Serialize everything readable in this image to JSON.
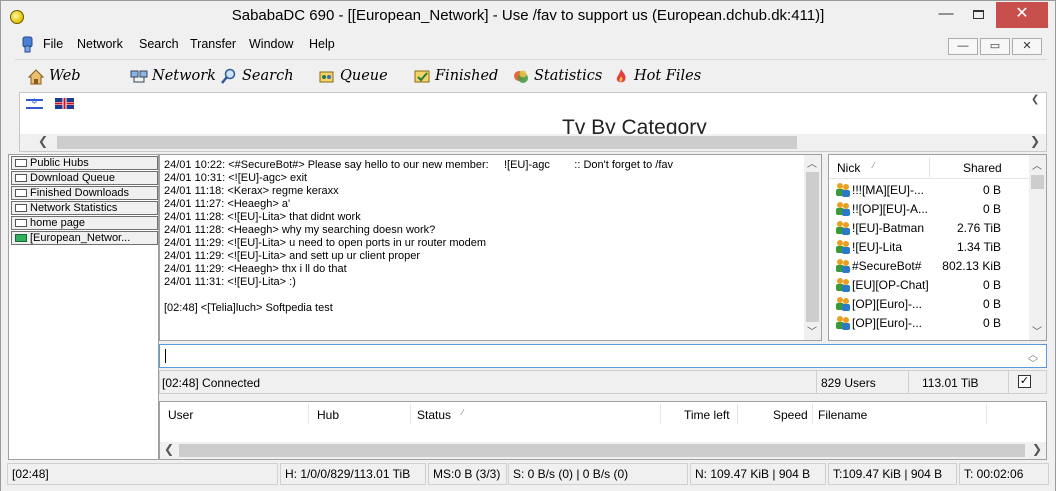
{
  "window": {
    "title": "SababaDC 690 - [[European_Network] - Use /fav   to support us  (European.dchub.dk:411)]",
    "minimize": "—",
    "close": "✕"
  },
  "menu": {
    "items": [
      "File",
      "Network",
      "Search",
      "Transfer",
      "Window",
      "Help"
    ],
    "mdi_min": "—",
    "mdi_max": "▭",
    "mdi_close": "✕"
  },
  "toolbar": {
    "items": [
      "Web",
      "Network",
      "Search",
      "Queue",
      "Finished",
      "Statistics",
      "Hot Files"
    ]
  },
  "hub_info": {
    "category_title": "Tv By Category"
  },
  "tabs": [
    {
      "label": "Public Hubs",
      "active": false
    },
    {
      "label": "Download Queue",
      "active": false
    },
    {
      "label": "Finished Downloads",
      "active": false
    },
    {
      "label": "Network Statistics",
      "active": false
    },
    {
      "label": "home page",
      "active": false
    },
    {
      "label": "[European_Networ...",
      "active": true
    }
  ],
  "chat": {
    "lines": [
      "24/01 10:22: <#SecureBot#> Please say hello to our new member:     ![EU]-agc        :: Don't forget to /fav",
      "24/01 10:31: <![EU]-agc> exit",
      "24/01 11:18: <Kerax> regme keraxx",
      "24/01 11:27: <Heaegh> a'",
      "24/01 11:28: <![EU]-Lita> that didnt work",
      "24/01 11:28: <Heaegh> why my searching doesn work?",
      "24/01 11:29: <![EU]-Lita> u need to open ports in ur router modem",
      "24/01 11:29: <![EU]-Lita> and sett up ur client proper",
      "24/01 11:29: <Heaegh> thx i ll do that",
      "24/01 11:31: <![EU]-Lita> :)",
      "",
      "[02:48] <[Telia]luch> Softpedia test"
    ]
  },
  "userlist": {
    "col_nick": "Nick",
    "col_shared": "Shared",
    "users": [
      {
        "nick": "!!![MA][EU]-...",
        "shared": "0 B"
      },
      {
        "nick": "!![OP][EU]-A...",
        "shared": "0 B"
      },
      {
        "nick": "![EU]-Batman",
        "shared": "2.76 TiB"
      },
      {
        "nick": "![EU]-Lita",
        "shared": "1.34 TiB"
      },
      {
        "nick": "#SecureBot#",
        "shared": "802.13 KiB"
      },
      {
        "nick": "[EU][OP-Chat]",
        "shared": "0 B"
      },
      {
        "nick": "[OP][Euro]-...",
        "shared": "0 B"
      },
      {
        "nick": "[OP][Euro]-...",
        "shared": "0 B"
      }
    ]
  },
  "message_input": {
    "value": ""
  },
  "hub_status": {
    "message": "[02:48] Connected",
    "users": "829 Users",
    "shared": "113.01 TiB",
    "checkbox": "✓"
  },
  "transfers": {
    "columns": [
      "User",
      "Hub",
      "Status",
      "Time left",
      "Speed",
      "Filename"
    ]
  },
  "statusbar": {
    "time": "[02:48]",
    "hubs": "H: 1/0/0/829/113.01 TiB",
    "slots": "MS:0 B (3/3)",
    "speed": "S: 0 B/s (0) | 0 B/s (0)",
    "net": "N: 109.47 KiB | 904 B",
    "total": "T:109.47 KiB | 904 B",
    "uptime": "T: 00:02:06"
  }
}
